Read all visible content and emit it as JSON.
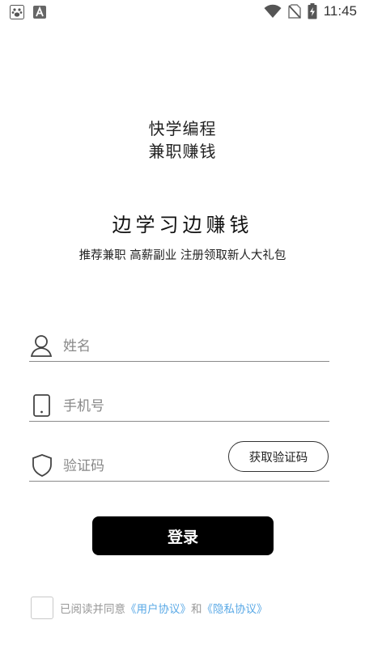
{
  "status_bar": {
    "time": "11:45",
    "left_icons": [
      "baidu-paw-icon",
      "font-a-icon"
    ],
    "right_icons": [
      "wifi-icon",
      "no-sim-icon",
      "battery-charging-icon"
    ]
  },
  "logo": {
    "line1": "快学编程",
    "line2": "兼职赚钱"
  },
  "headline": "边学习边赚钱",
  "subline": "推荐兼职 高薪副业 注册领取新人大礼包",
  "form": {
    "name_placeholder": "姓名",
    "phone_placeholder": "手机号",
    "code_placeholder": "验证码",
    "get_code_label": "获取验证码",
    "login_label": "登录"
  },
  "agreement": {
    "prefix": "已阅读并同意",
    "user_agreement": "《用户协议》",
    "conjunction": "和",
    "privacy_agreement": "《隐私协议》",
    "link_color": "#5aa9e6"
  }
}
